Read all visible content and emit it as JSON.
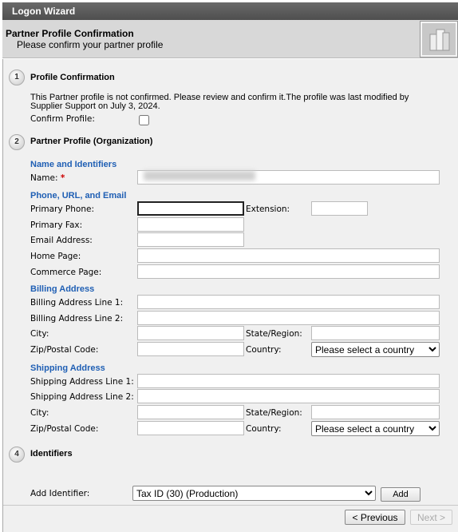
{
  "window": {
    "title": "Logon Wizard"
  },
  "header": {
    "title": "Partner Profile Confirmation",
    "subtitle": "Please confirm your partner profile",
    "icon": "building-icon"
  },
  "step1": {
    "number": "1",
    "title": "Profile Confirmation",
    "message": "This Partner profile is not confirmed. Please review and confirm it.The profile was last modified by Supplier Support on July 3, 2024.",
    "confirm_label": "Confirm Profile:",
    "confirmed": false
  },
  "step2": {
    "number": "2",
    "title": "Partner Profile (Organization)",
    "name_section": "Name and Identifiers",
    "name_label": "Name:",
    "required": "*",
    "phone_section": "Phone, URL, and Email",
    "primary_phone": "Primary Phone:",
    "extension": "Extension:",
    "primary_fax": "Primary Fax:",
    "email": "Email Address:",
    "home_page": "Home Page:",
    "commerce_page": "Commerce Page:",
    "billing_section": "Billing Address",
    "billing_line1": "Billing Address Line 1:",
    "billing_line2": "Billing Address Line 2:",
    "city": "City:",
    "state": "State/Region:",
    "zip": "Zip/Postal Code:",
    "country": "Country:",
    "country_placeholder": "Please select a country",
    "shipping_section": "Shipping Address",
    "shipping_line1": "Shipping Address Line 1:",
    "shipping_line2": "Shipping Address Line 2:"
  },
  "step4": {
    "number": "4",
    "title": "Identifiers",
    "add_label": "Add Identifier:",
    "selected": "Tax ID (30) (Production)",
    "add_button": "Add"
  },
  "footer": {
    "previous": "< Previous",
    "next": "Next >"
  }
}
